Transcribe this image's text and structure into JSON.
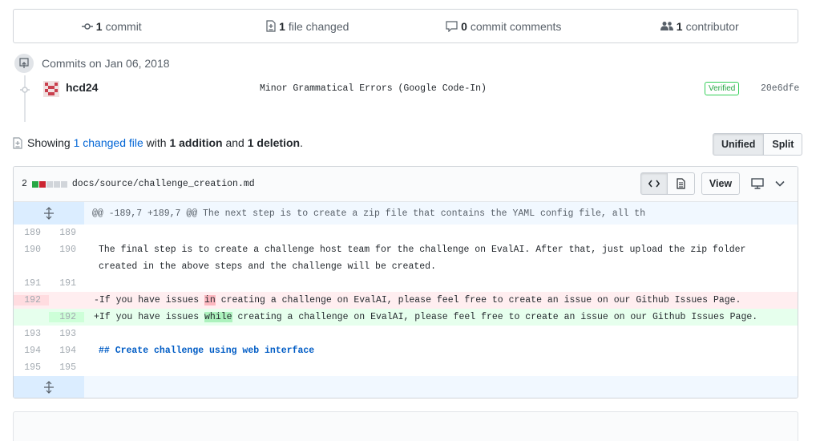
{
  "summary": {
    "commits_count": "1",
    "commits_label": "commit",
    "files_count": "1",
    "files_label": "file changed",
    "comments_count": "0",
    "comments_label": "commit comments",
    "contributors_count": "1",
    "contributors_label": "contributor"
  },
  "commits": {
    "date_label": "Commits on Jan 06, 2018",
    "author": "hcd24",
    "message": "Minor Grammatical Errors (Google Code-In)",
    "verified": "Verified",
    "sha": "20e6dfe"
  },
  "showing": {
    "prefix": "Showing",
    "changed_link": "1 changed file",
    "with": "with",
    "additions": "1 addition",
    "and": "and",
    "deletions": "1 deletion",
    "period": "."
  },
  "view_toggle": {
    "unified": "Unified",
    "split": "Split"
  },
  "file": {
    "change_count": "2",
    "path": "docs/source/challenge_creation.md",
    "view_button": "View",
    "hunk_header": "@@ -189,7 +189,7 @@ The next step is to create a zip file that contains the YAML config file, all th",
    "lines": [
      {
        "old": "189",
        "new": "189",
        "text": ""
      },
      {
        "old": "190",
        "new": "190",
        "text": "The final step is to create a challenge host team for the challenge on EvalAI. After that, just upload the zip folder created in the above steps and the challenge will be created."
      },
      {
        "old": "191",
        "new": "191",
        "text": ""
      },
      {
        "old": "192",
        "new": "",
        "pre": "-If you have issues ",
        "mark": "in",
        "post": " creating a challenge on EvalAI, please feel free to create an issue on our Github Issues Page."
      },
      {
        "old": "",
        "new": "192",
        "pre": "+If you have issues ",
        "mark": "while",
        "post": " creating a challenge on EvalAI, please feel free to create an issue on our Github Issues Page."
      },
      {
        "old": "193",
        "new": "193",
        "text": ""
      },
      {
        "old": "194",
        "new": "194",
        "text": "## Create challenge using web interface"
      },
      {
        "old": "195",
        "new": "195",
        "text": ""
      }
    ]
  },
  "colors": {
    "add": "#28a745",
    "del": "#cb2431",
    "neutral": "#d1d5da",
    "link": "#0366d6"
  }
}
